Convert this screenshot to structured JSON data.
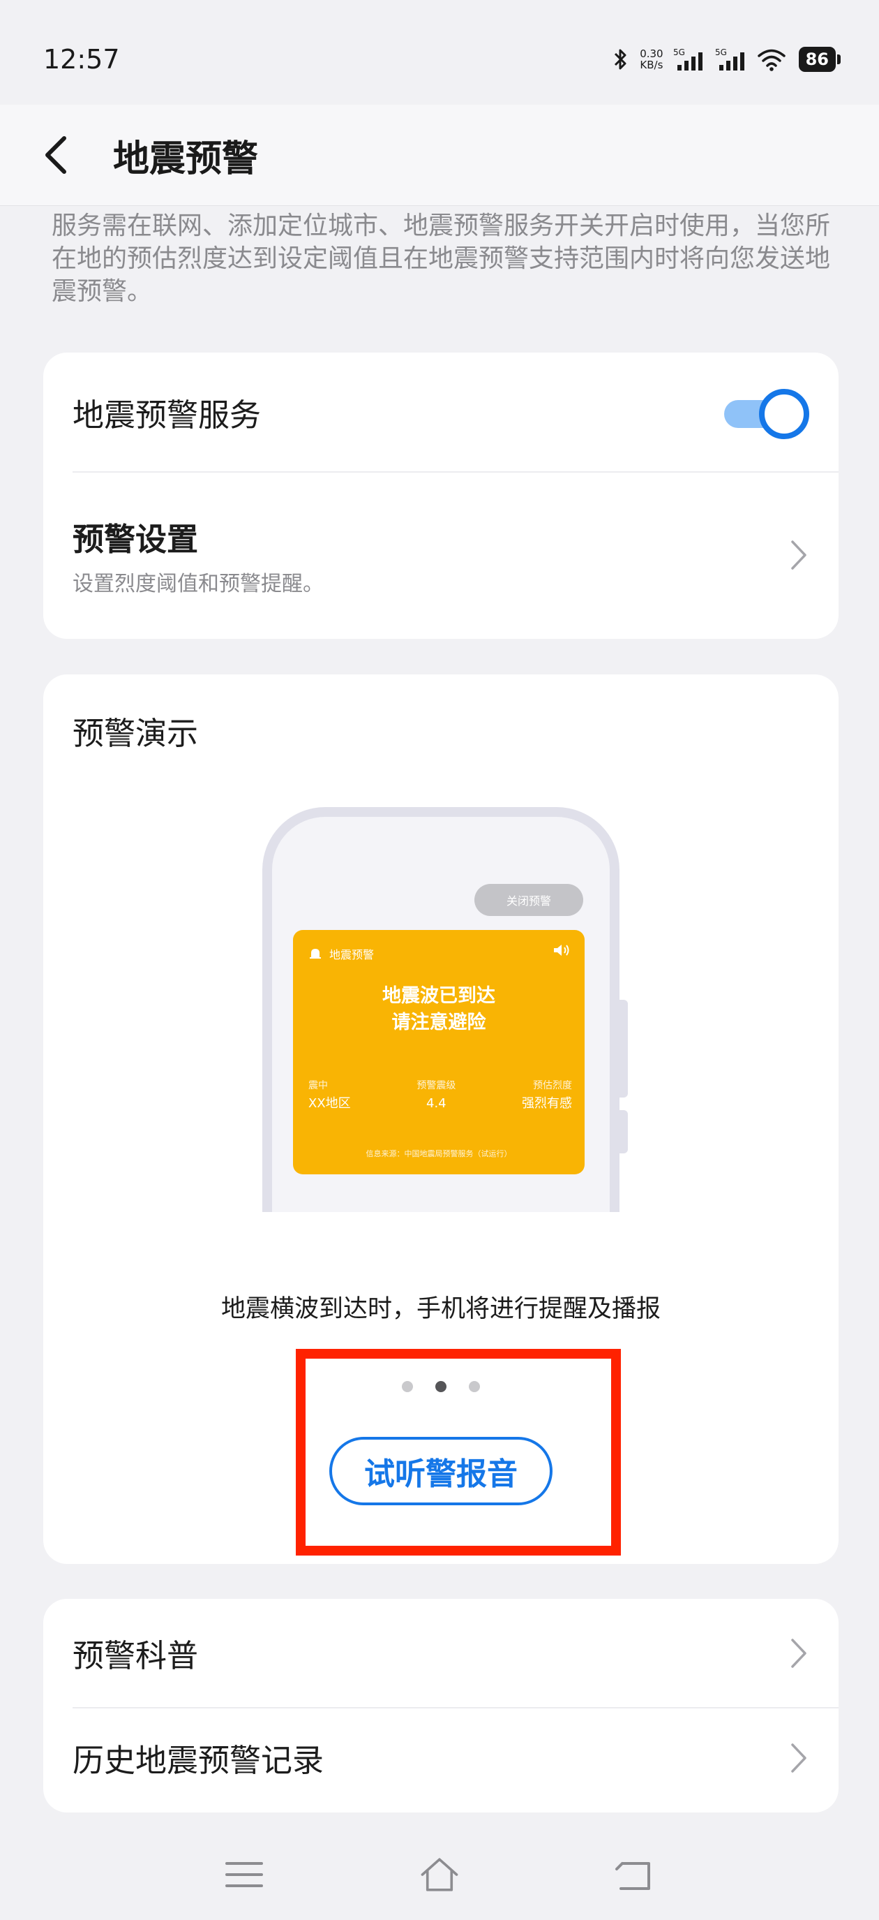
{
  "status_bar": {
    "time": "12:57",
    "net_speed_value": "0.30",
    "net_speed_unit": "KB/s",
    "signal_1_label": "5G",
    "signal_2_label": "5G",
    "battery": "86"
  },
  "header": {
    "title": "地震预警",
    "back_icon": "chevron-left-icon"
  },
  "intro": {
    "text": "服务需在联网、添加定位城市、地震预警服务开关开启时使用，当您所在地的预估烈度达到设定阈值且在地震预警支持范围内时将向您发送地震预警。"
  },
  "service_card": {
    "service_label": "地震预警服务",
    "service_enabled": true,
    "settings_label": "预警设置",
    "settings_sub": "设置烈度阈值和预警提醒。"
  },
  "demo_card": {
    "title": "预警演示",
    "phone": {
      "pill_label": "关闭预警",
      "alert_app_label": "地震预警",
      "alert_line1": "地震波已到达",
      "alert_line2": "请注意避险",
      "stats": [
        {
          "label": "震中",
          "value": "XX地区"
        },
        {
          "label": "预警震级",
          "value": "4.4"
        },
        {
          "label": "预估烈度",
          "value": "强烈有感"
        }
      ],
      "alert_footer": "信息来源：中国地震局预警服务（试运行）"
    },
    "caption": "地震横波到达时，手机将进行提醒及播报",
    "carousel": {
      "total": 3,
      "active_index": 1
    },
    "listen_button": "试听警报音"
  },
  "links_card": {
    "items": [
      {
        "label": "预警科普"
      },
      {
        "label": "历史地震预警记录"
      }
    ]
  },
  "colors": {
    "accent": "#1577e8",
    "alert_bg": "#f9b404",
    "highlight": "#ff2200",
    "page_bg": "#f1f1f4"
  }
}
